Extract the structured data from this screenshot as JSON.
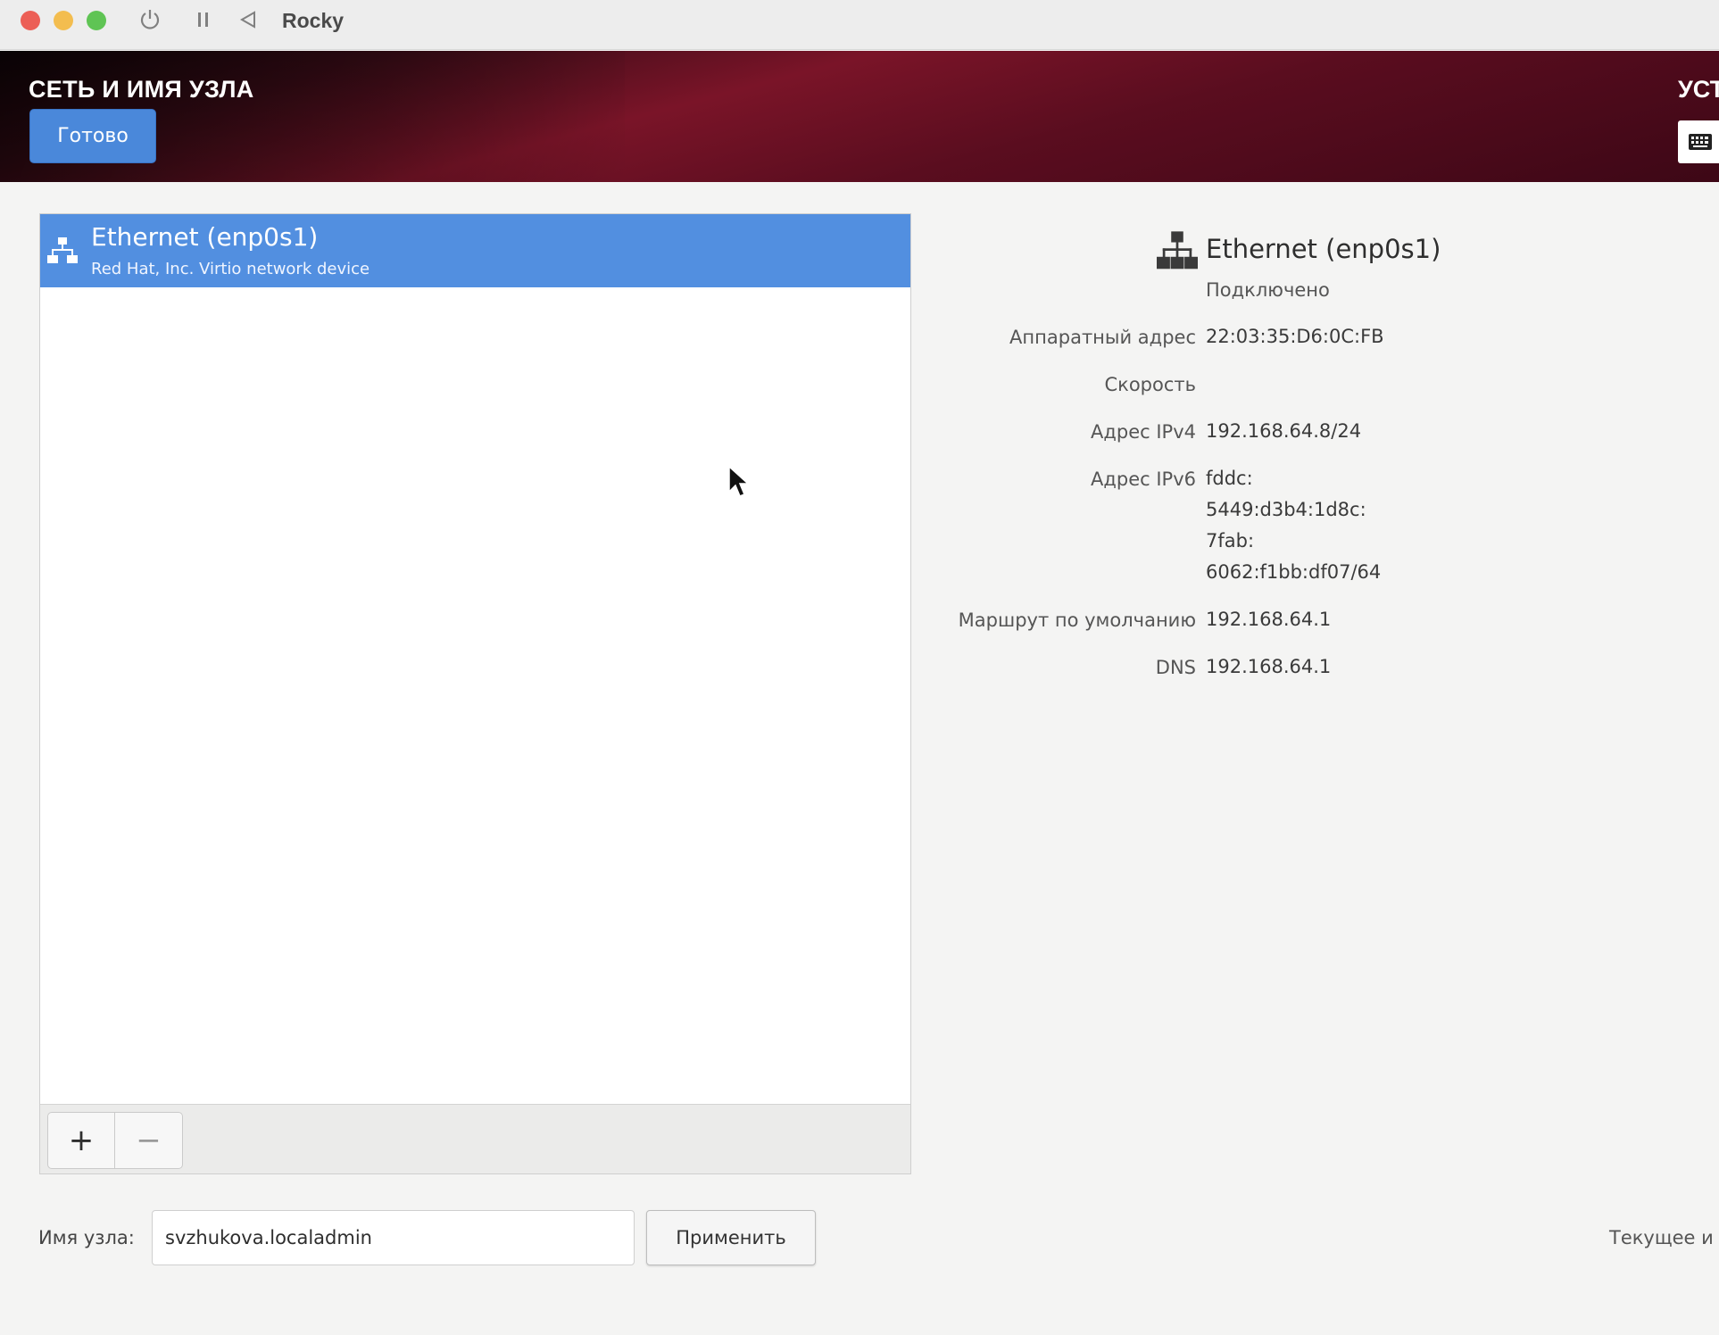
{
  "window": {
    "title": "Rocky",
    "controls": [
      "power-icon",
      "pause-icon",
      "back-icon"
    ]
  },
  "header": {
    "title": "СЕТЬ И ИМЯ УЗЛА",
    "done_label": "Готово",
    "right_text_partial": "УСТ",
    "keyboard_icon": "keyboard-icon"
  },
  "device_list": {
    "items": [
      {
        "name": "Ethernet (enp0s1)",
        "description": "Red Hat, Inc. Virtio network device",
        "selected": true,
        "icon": "network-wired-icon"
      }
    ],
    "add_label": "+",
    "remove_label": "−"
  },
  "details": {
    "title": "Ethernet (enp0s1)",
    "status": "Подключено",
    "rows": [
      {
        "label": "Аппаратный адрес",
        "value": "22:03:35:D6:0C:FB"
      },
      {
        "label": "Скорость",
        "value": ""
      },
      {
        "label": "Адрес IPv4",
        "value": "192.168.64.8/24"
      },
      {
        "label": "Адрес IPv6",
        "value_lines": [
          "fddc:",
          "5449:d3b4:1d8c:",
          "7fab:",
          "6062:f1bb:df07/64"
        ]
      },
      {
        "label": "Маршрут по умолчанию",
        "value": "192.168.64.1"
      },
      {
        "label": "DNS",
        "value": "192.168.64.1"
      }
    ]
  },
  "hostname": {
    "label": "Имя узла:",
    "value": "svzhukova.localadmin",
    "apply_label": "Применить",
    "current_label_partial": "Текущее и"
  },
  "colors": {
    "accent": "#4a88da",
    "selection": "#528fe0",
    "header_red": "#7a1428"
  }
}
